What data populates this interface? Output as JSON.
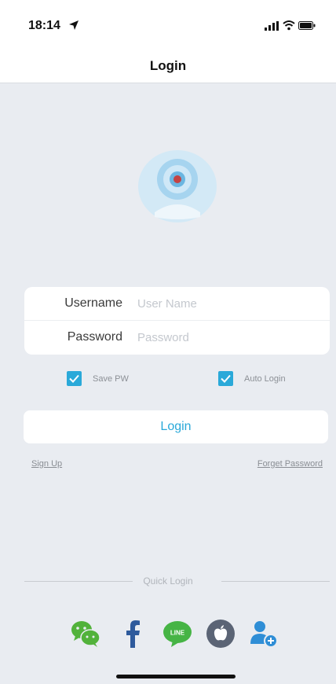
{
  "status_bar": {
    "time": "18:14"
  },
  "nav": {
    "title": "Login"
  },
  "form": {
    "username_label": "Username",
    "username_placeholder": "User Name",
    "password_label": "Password",
    "password_placeholder": "Password"
  },
  "options": {
    "save_pw_label": "Save PW",
    "save_pw_checked": true,
    "auto_login_label": "Auto Login",
    "auto_login_checked": true
  },
  "login_button_label": "Login",
  "links": {
    "sign_up": "Sign Up",
    "forget_password": "Forget Password"
  },
  "quick_login": {
    "label": "Quick Login",
    "providers": [
      "wechat-icon",
      "facebook-icon",
      "line-icon",
      "apple-icon",
      "add-user-icon"
    ]
  },
  "colors": {
    "accent": "#2aa9d9",
    "background": "#e9ecf1",
    "wechat": "#52b23b",
    "facebook": "#2e5a9c",
    "line": "#46b445",
    "apple": "#5b6475",
    "user": "#2f8ed6"
  }
}
